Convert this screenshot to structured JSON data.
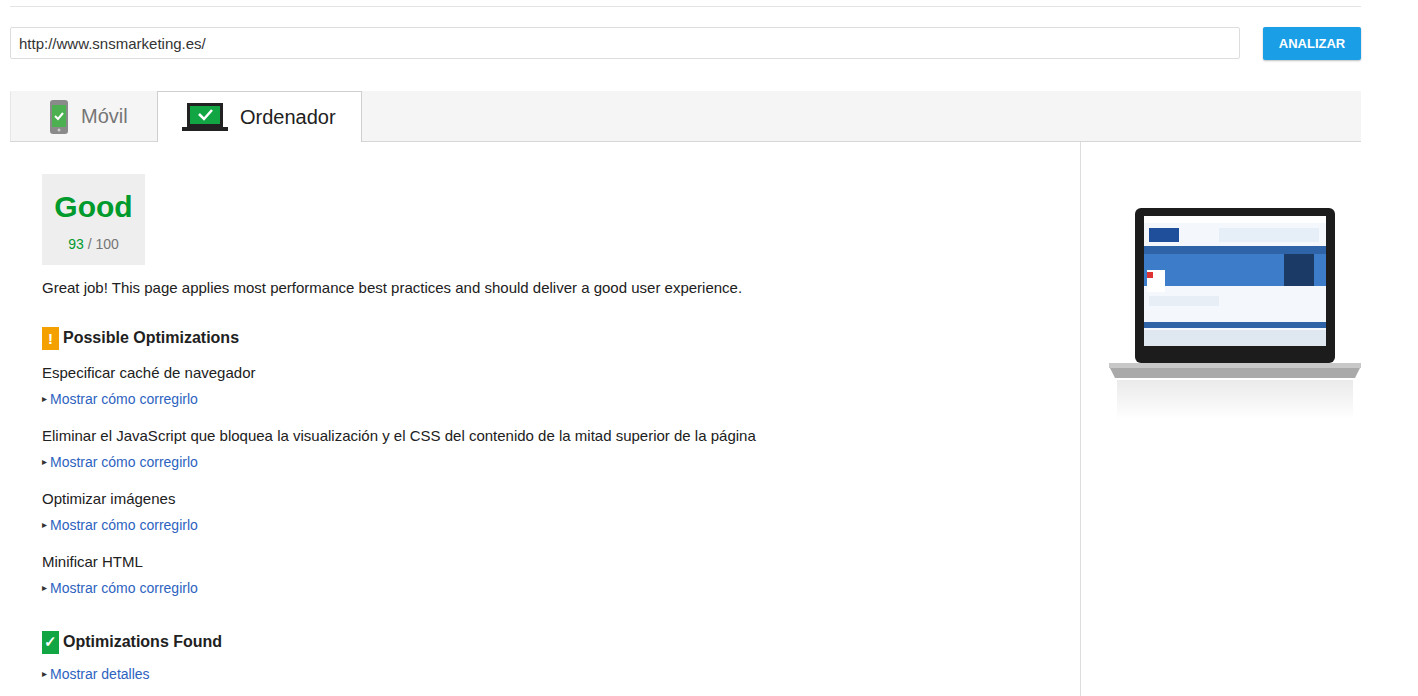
{
  "url": {
    "value": "http://www.snsmarketing.es/"
  },
  "analyze_button": {
    "label": "ANALIZAR"
  },
  "tabs": [
    {
      "label": "Móvil",
      "selected": false,
      "kind": "mobile"
    },
    {
      "label": "Ordenador",
      "selected": true,
      "kind": "desktop"
    }
  ],
  "score": {
    "label": "Good",
    "value": "93",
    "max": "/ 100"
  },
  "summary": "Great job! This page applies most performance best practices and should deliver a good user experience.",
  "possible_optimizations": {
    "title": "Possible Optimizations",
    "icon": "!",
    "items": [
      {
        "title": "Especificar caché de navegador",
        "arrow": "▸",
        "link": "Mostrar cómo corregirlo"
      },
      {
        "title": "Eliminar el JavaScript que bloquea la visualización y el CSS del contenido de la mitad superior de la página",
        "arrow": "▸",
        "link": "Mostrar cómo corregirlo"
      },
      {
        "title": "Optimizar imágenes",
        "arrow": "▸",
        "link": "Mostrar cómo corregirlo"
      },
      {
        "title": "Minificar HTML",
        "arrow": "▸",
        "link": "Mostrar cómo corregirlo"
      }
    ]
  },
  "optimizations_found": {
    "title": "Optimizations Found",
    "icon": "✓",
    "arrow": "▸",
    "link": "Mostrar detalles"
  }
}
